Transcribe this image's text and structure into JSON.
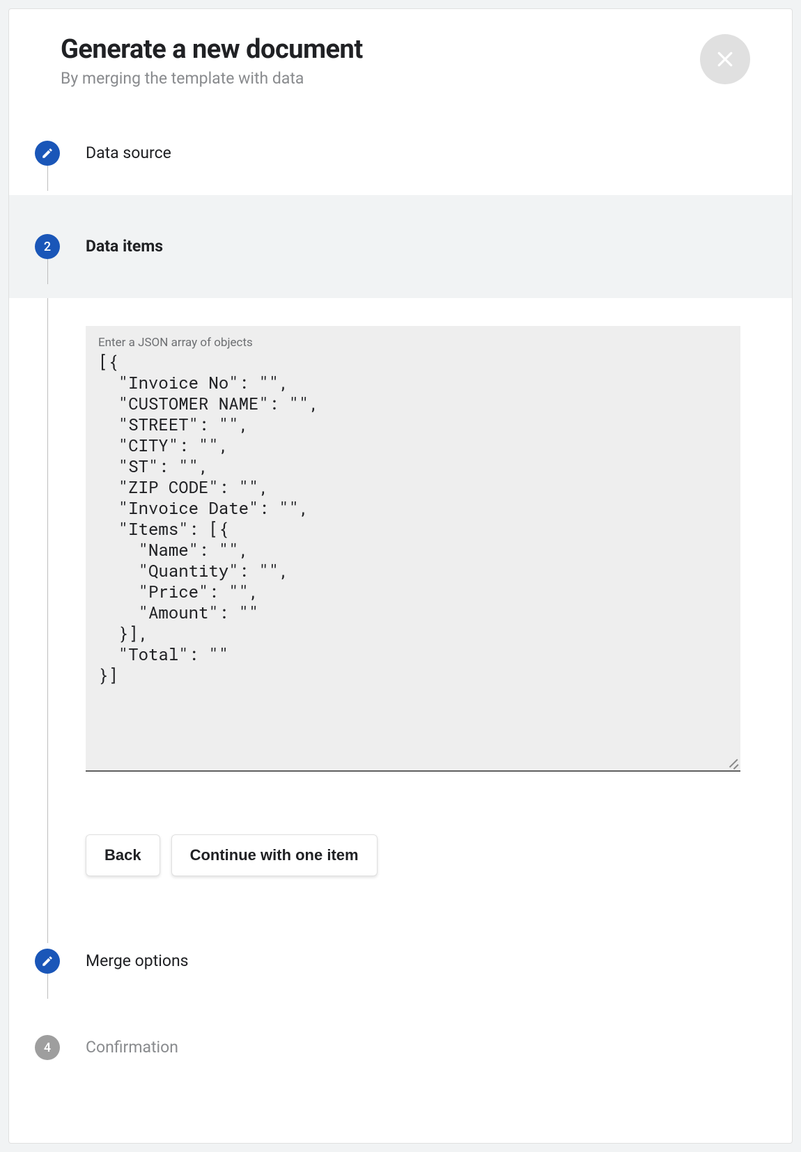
{
  "header": {
    "title": "Generate a new document",
    "subtitle": "By merging the template with data"
  },
  "steps": {
    "s1": {
      "label": "Data source"
    },
    "s2": {
      "number": "2",
      "label": "Data items"
    },
    "s3": {
      "label": "Merge options"
    },
    "s4": {
      "number": "4",
      "label": "Confirmation"
    }
  },
  "dataItems": {
    "fieldLabel": "Enter a JSON array of objects",
    "jsonValue": "[{\n  \"Invoice No\": \"\",\n  \"CUSTOMER NAME\": \"\",\n  \"STREET\": \"\",\n  \"CITY\": \"\",\n  \"ST\": \"\",\n  \"ZIP CODE\": \"\",\n  \"Invoice Date\": \"\",\n  \"Items\": [{\n    \"Name\": \"\",\n    \"Quantity\": \"\",\n    \"Price\": \"\",\n    \"Amount\": \"\"\n  }],\n  \"Total\": \"\"\n}]"
  },
  "buttons": {
    "back": "Back",
    "continue": "Continue with one item"
  }
}
